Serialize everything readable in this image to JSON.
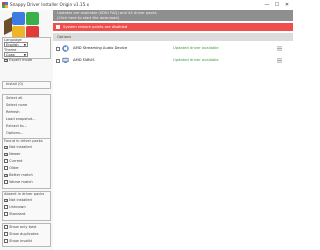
{
  "window": {
    "title": "Snappy Driver Installer Origin v1.15.x",
    "minimize": "—",
    "maximize": "☐",
    "close": "✕"
  },
  "sidebar": {
    "language_label": "Language",
    "language_value": "English",
    "theme_label": "Theme",
    "theme_value": "Coax",
    "expert_mode": "Expert mode",
    "install_label": "Install (0)",
    "actions": [
      "Select all",
      "Select none",
      "Refresh",
      "Load snapshot...",
      "Extract to...",
      "Options..."
    ],
    "found_header": "Found in driver packs",
    "found_filters": [
      {
        "label": "Not installed",
        "checked": true
      },
      {
        "label": "Newer",
        "checked": true
      },
      {
        "label": "Current",
        "checked": false
      },
      {
        "label": "Older",
        "checked": false
      },
      {
        "label": "Better match",
        "checked": true
      },
      {
        "label": "Worse match",
        "checked": false
      }
    ],
    "absent_header": "Absent in driver packs",
    "absent_filters": [
      {
        "label": "Not installed",
        "checked": true
      },
      {
        "label": "Unknown",
        "checked": false
      },
      {
        "label": "Standard",
        "checked": false
      }
    ],
    "show_filters": [
      {
        "label": "Show only best",
        "checked": false
      },
      {
        "label": "Show duplicates",
        "checked": false
      },
      {
        "label": "Show invalid",
        "checked": false
      }
    ]
  },
  "main": {
    "header_line1": "Updates are available (SDIO FAQ) and 44 driver packs",
    "header_line2": "(Click here to start the download)",
    "error_text": "System restore points are disabled",
    "options_label": "Options",
    "devices": [
      {
        "name": "AMD Streaming Audio Device",
        "status": "Updated driver available"
      },
      {
        "name": "AMD FABUS",
        "status": "Updated driver available"
      }
    ]
  },
  "colors": {
    "error_bg": "#f24d4d",
    "header_bg": "#8f8f8f",
    "status_green": "#3c9a3c"
  }
}
